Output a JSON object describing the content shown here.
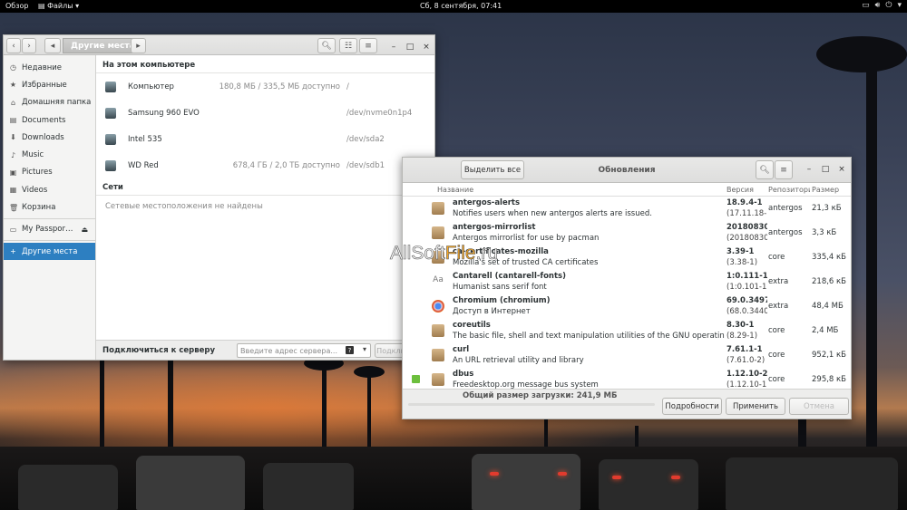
{
  "topbar": {
    "overview": "Обзор",
    "app_menu": "Файлы",
    "clock": "Сб, 8 сентября, 07:41"
  },
  "file_manager": {
    "path_segment": "Другие места",
    "sidebar": [
      {
        "label": "Недавние",
        "icon": "clock-icon"
      },
      {
        "label": "Избранные",
        "icon": "star-icon"
      },
      {
        "label": "Домашняя папка",
        "icon": "home-icon"
      },
      {
        "label": "Documents",
        "icon": "document-icon"
      },
      {
        "label": "Downloads",
        "icon": "download-icon"
      },
      {
        "label": "Music",
        "icon": "music-icon"
      },
      {
        "label": "Pictures",
        "icon": "picture-icon"
      },
      {
        "label": "Videos",
        "icon": "video-icon"
      },
      {
        "label": "Корзина",
        "icon": "trash-icon"
      },
      {
        "label": "My Passpor…",
        "icon": "drive-icon"
      },
      {
        "label": "Другие места",
        "icon": "plus-icon"
      }
    ],
    "section_this_computer": "На этом компьютере",
    "locations": [
      {
        "name": "Компьютер",
        "space": "180,8 МБ / 335,5 МБ доступно",
        "device": "/"
      },
      {
        "name": "Samsung 960 EVO",
        "space": "",
        "device": "/dev/nvme0n1p4"
      },
      {
        "name": "Intel 535",
        "space": "",
        "device": "/dev/sda2"
      },
      {
        "name": "WD Red",
        "space": "678,4 ГБ / 2,0 ТБ доступно",
        "device": "/dev/sdb1"
      }
    ],
    "section_networks": "Сети",
    "networks_empty": "Сетевые местоположения не найдены",
    "connect_label": "Подключиться к серверу",
    "server_placeholder": "Введите адрес сервера...",
    "connect_button": "Подключиться"
  },
  "updates": {
    "select_all": "Выделить все",
    "title": "Обновления",
    "columns": {
      "name": "Название",
      "version": "Версия",
      "repo": "Репозиторий",
      "size": "Размер"
    },
    "packages": [
      {
        "name": "antergos-alerts",
        "desc": "Notifies users when new antergos alerts are issued.",
        "ver": "18.9.4-1",
        "old": "(17.11.18-1)",
        "repo": "antergos",
        "size": "21,3 кБ"
      },
      {
        "name": "antergos-mirrorlist",
        "desc": "Antergos mirrorlist for use by pacman",
        "ver": "20180830-2",
        "old": "(20180830-1)",
        "repo": "antergos",
        "size": "3,3 кБ"
      },
      {
        "name": "ca-certificates-mozilla",
        "desc": "Mozilla's set of trusted CA certificates",
        "ver": "3.39-1",
        "old": "(3.38-1)",
        "repo": "core",
        "size": "335,4 кБ"
      },
      {
        "name": "Cantarell  (cantarell-fonts)",
        "desc": "Humanist sans serif font",
        "ver": "1:0.111-1",
        "old": "(1:0.101-1)",
        "repo": "extra",
        "size": "218,6 кБ"
      },
      {
        "name": "Chromium  (chromium)",
        "desc": "Доступ в Интернет",
        "ver": "69.0.3497.81-1",
        "old": "(68.0.3440.106-1)",
        "repo": "extra",
        "size": "48,4 МБ"
      },
      {
        "name": "coreutils",
        "desc": "The basic file, shell and text manipulation utilities of the GNU operating system",
        "ver": "8.30-1",
        "old": "(8.29-1)",
        "repo": "core",
        "size": "2,4 МБ"
      },
      {
        "name": "curl",
        "desc": "An URL retrieval utility and library",
        "ver": "7.61.1-1",
        "old": "(7.61.0-2)",
        "repo": "core",
        "size": "952,1 кБ"
      },
      {
        "name": "dbus",
        "desc": "Freedesktop.org message bus system",
        "ver": "1.12.10-2",
        "old": "(1.12.10-1)",
        "repo": "core",
        "size": "295,8 кБ"
      }
    ],
    "total": "Общий размер загрузки: 241,9 МБ",
    "details_button": "Подробности",
    "apply_button": "Применить",
    "cancel_button": "Отмена"
  },
  "watermark": {
    "part1": "AllSoft",
    "part2": "File",
    "part3": ".ru"
  }
}
